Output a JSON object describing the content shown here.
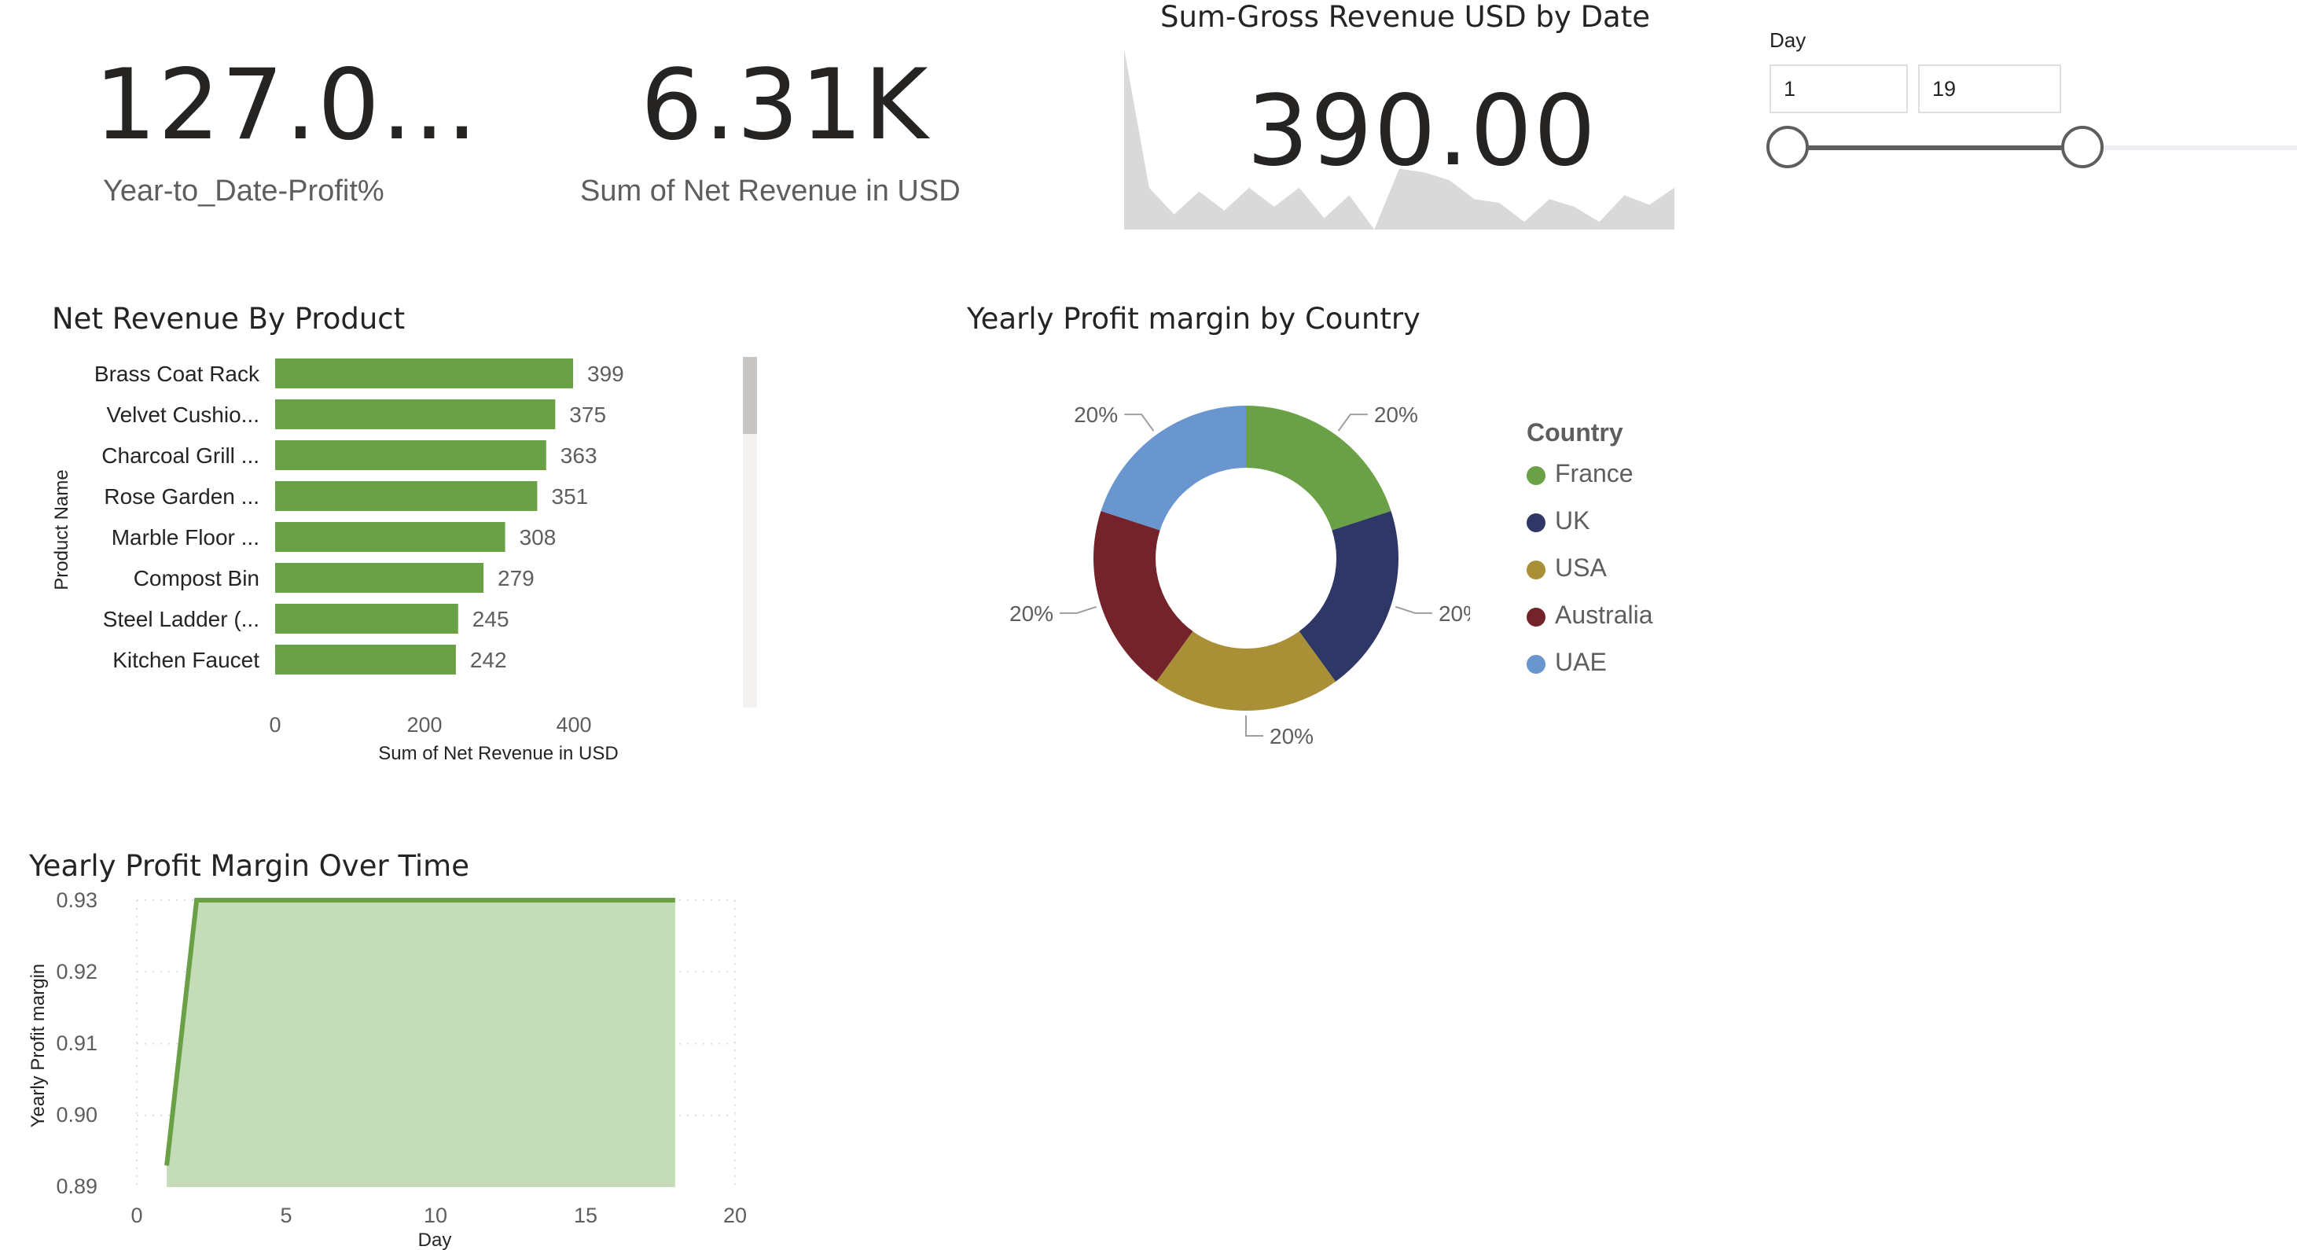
{
  "kpis": {
    "profit": {
      "value": "127.0...",
      "label": "Year-to_Date-Profit%"
    },
    "net_revenue": {
      "value": "6.31K",
      "label": "Sum of Net Revenue in USD"
    },
    "gross": {
      "title": "Sum-Gross Revenue USD by Date",
      "value": "390.00"
    }
  },
  "sparkline": [
    0.95,
    0.22,
    0.08,
    0.2,
    0.1,
    0.22,
    0.12,
    0.22,
    0.06,
    0.18,
    0.0,
    0.32,
    0.3,
    0.26,
    0.16,
    0.14,
    0.04,
    0.16,
    0.12,
    0.04,
    0.18,
    0.13,
    0.22
  ],
  "slicer": {
    "label": "Day",
    "min_value": "1",
    "max_value": "19",
    "range_min": 1,
    "range_max": 19
  },
  "bar_chart": {
    "title": "Net Revenue By Product",
    "xlabel": "Sum of Net Revenue in USD",
    "ylabel": "Product Name",
    "ticks": [
      "0",
      "200",
      "400"
    ]
  },
  "donut_chart": {
    "title": "Yearly Profit margin by Country",
    "legend_title": "Country"
  },
  "line_chart": {
    "title": "Yearly Profit Margin Over Time",
    "ylabel": "Yearly Profit margin",
    "xlabel": "Day",
    "yticks": [
      "0.93",
      "0.92",
      "0.91",
      "0.90",
      "0.89"
    ],
    "xticks": [
      "0",
      "5",
      "10",
      "15",
      "20"
    ]
  },
  "chart_data": [
    {
      "type": "bar",
      "title": "Net Revenue By Product",
      "xlabel": "Sum of Net Revenue in USD",
      "ylabel": "Product Name",
      "categories": [
        "Brass Coat Rack",
        "Velvet Cushio...",
        "Charcoal Grill ...",
        "Rose Garden ...",
        "Marble Floor ...",
        "Compost Bin",
        "Steel Ladder (...",
        "Kitchen Faucet"
      ],
      "values": [
        399,
        375,
        363,
        351,
        308,
        279,
        245,
        242
      ],
      "xlim": [
        0,
        400
      ],
      "color": "#6aa146"
    },
    {
      "type": "pie",
      "title": "Yearly Profit margin by Country",
      "legend_title": "Country",
      "categories": [
        "France",
        "UK",
        "USA",
        "Australia",
        "UAE"
      ],
      "values": [
        20,
        20,
        20,
        20,
        20
      ],
      "labels": [
        "20%",
        "20%",
        "20%",
        "20%",
        "20%"
      ],
      "colors": [
        "#6aa146",
        "#2e3766",
        "#a99037",
        "#74232a",
        "#6a96d0"
      ]
    },
    {
      "type": "area",
      "title": "Yearly Profit Margin Over Time",
      "xlabel": "Day",
      "ylabel": "Yearly Profit margin",
      "x": [
        1,
        2,
        18
      ],
      "y": [
        0.893,
        0.93,
        0.93
      ],
      "xlim": [
        0,
        20
      ],
      "ylim": [
        0.89,
        0.93
      ],
      "line_color": "#6aa146",
      "fill_color": "#c4dcb7"
    }
  ]
}
